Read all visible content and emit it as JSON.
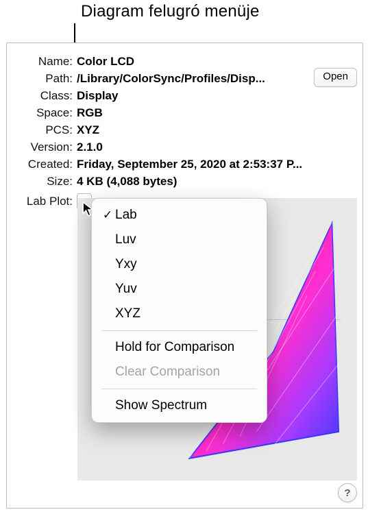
{
  "callout_label": "Diagram felugró menüje",
  "labels": {
    "name": "Name:",
    "path": "Path:",
    "class": "Class:",
    "space": "Space:",
    "pcs": "PCS:",
    "version": "Version:",
    "created": "Created:",
    "size": "Size:",
    "lab_plot": "Lab Plot:"
  },
  "values": {
    "name": "Color LCD",
    "path": "/Library/ColorSync/Profiles/Disp...",
    "class": "Display",
    "space": "RGB",
    "pcs": "XYZ",
    "version": "2.1.0",
    "created": "Friday, September 25, 2020 at 2:53:37 P...",
    "size": "4 KB (4,088 bytes)"
  },
  "buttons": {
    "open": "Open",
    "help": "?"
  },
  "menu": {
    "items": [
      {
        "label": "Lab",
        "checked": true,
        "enabled": true
      },
      {
        "label": "Luv",
        "checked": false,
        "enabled": true
      },
      {
        "label": "Yxy",
        "checked": false,
        "enabled": true
      },
      {
        "label": "Yuv",
        "checked": false,
        "enabled": true
      },
      {
        "label": "XYZ",
        "checked": false,
        "enabled": true
      }
    ],
    "hold": "Hold for Comparison",
    "clear": "Clear Comparison",
    "spectrum": "Show Spectrum"
  }
}
